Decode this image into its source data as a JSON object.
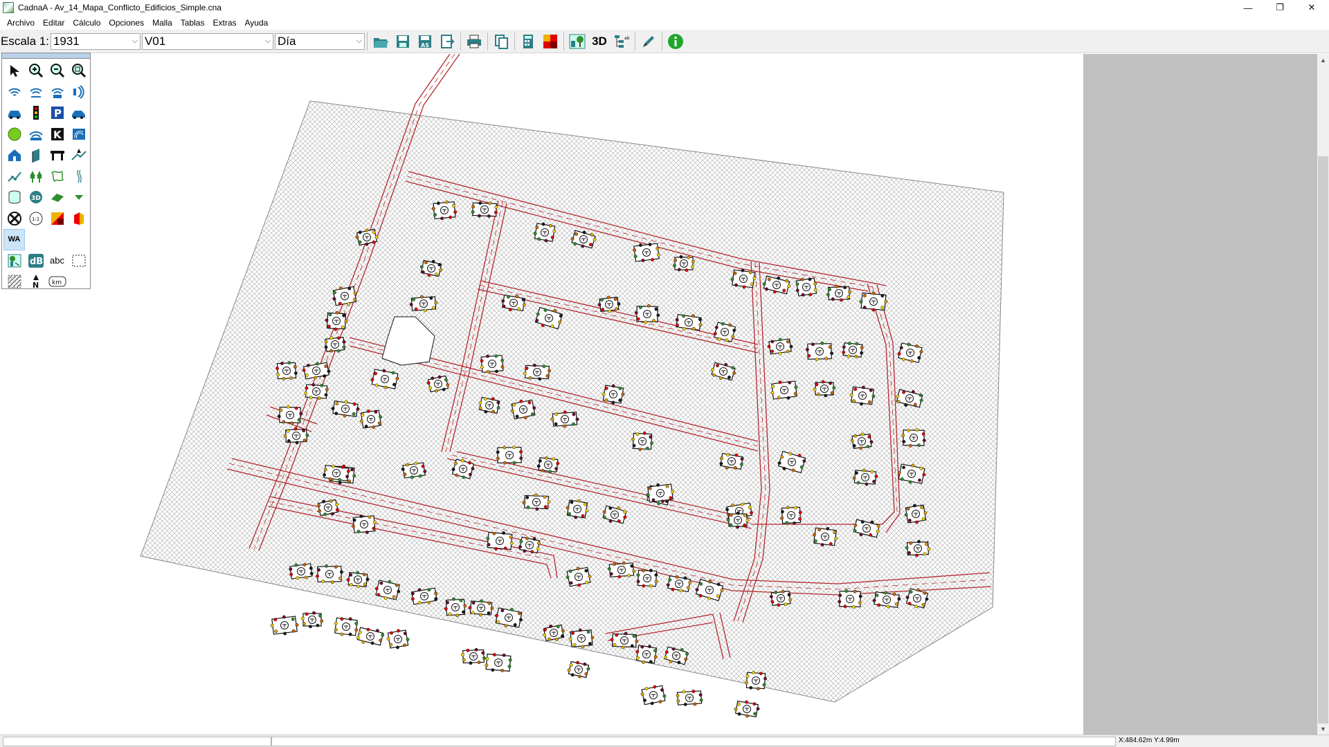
{
  "window": {
    "title": "CadnaA - Av_14_Mapa_Conflicto_Edificios_Simple.cna",
    "controls": [
      "—",
      "❐",
      "✕"
    ]
  },
  "menu": [
    {
      "label": "Archivo"
    },
    {
      "label": "Editar"
    },
    {
      "label": "Cálculo"
    },
    {
      "label": "Opciones"
    },
    {
      "label": "Malla"
    },
    {
      "label": "Tablas"
    },
    {
      "label": "Extras"
    },
    {
      "label": "Ayuda"
    }
  ],
  "toolbar": {
    "scale_label": "Escala 1:",
    "scale_value": "1931",
    "variant_value": "V01",
    "period_value": "Día",
    "label_3d": "3D",
    "icons": [
      "open-icon",
      "save-icon",
      "save-as-icon",
      "export-icon",
      "print-icon",
      "copy-icon",
      "calculator-icon",
      "color-grid-icon",
      "tree-map-icon",
      "3d-icon",
      "object-tree-icon",
      "pen-icon",
      "info-icon"
    ]
  },
  "palette": {
    "items": [
      "pointer-icon",
      "zoom-in-icon",
      "zoom-out-icon",
      "zoom-extent-icon",
      "point-source-icon",
      "line-source-icon",
      "area-source-icon",
      "vertical-source-icon",
      "road-icon",
      "traffic-light-icon",
      "parking-icon",
      "railway-icon",
      "industrial-source-icon",
      "leisure-source-icon",
      "k-source-icon",
      "sound-wall-icon",
      "building-icon",
      "barrier-icon",
      "bridge-icon",
      "embankment-icon",
      "contour-icon",
      "trees-icon",
      "terrain-area-icon",
      "river-icon",
      "cylinder-icon",
      "3d-reflector-icon",
      "ground-area-icon",
      "receiver-point-icon",
      "calc-area-icon",
      "grid-calc-icon",
      "grid-map-icon",
      "facade-map-icon",
      "wa-icon",
      "",
      "",
      "",
      "map-legend-icon",
      "db-label-icon",
      "abc-text-icon",
      "frame-icon",
      "hatch-icon",
      "north-arrow-icon",
      "km-scale-icon",
      ""
    ],
    "selected": "wa-icon",
    "labels": {
      "wa": "WA",
      "db": "dB",
      "abc": "abc",
      "k": "K",
      "km": "km"
    }
  },
  "status": {
    "coords": "X:484.62m Y:4.99m"
  },
  "colors": {
    "road": "#b3272d",
    "area_hatch": "#9a9a9a",
    "panel_gray": "#c0c0c0",
    "selection": "#cce4f7"
  }
}
